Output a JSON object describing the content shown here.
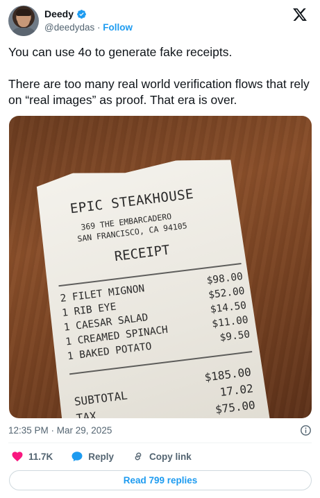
{
  "author": {
    "display_name": "Deedy",
    "handle": "@deedydas",
    "separator": "·",
    "follow_label": "Follow",
    "verified": true
  },
  "tweet": {
    "paragraphs": [
      "You can use 4o to generate fake receipts.",
      "There are too many real world verification flows that rely on “real images” as proof. That era is over."
    ],
    "timestamp": "12:35 PM · Mar 29, 2025"
  },
  "receipt": {
    "title": "EPIC STEAKHOUSE",
    "address": "369 THE EMBARCADERO",
    "city": "SAN FRANCISCO, CA 94105",
    "heading": "RECEIPT",
    "items": [
      {
        "name": "2 FILET MIGNON",
        "price": "$98.00"
      },
      {
        "name": "1 RIB EYE",
        "price": "$52.00"
      },
      {
        "name": "1 CAESAR SALAD",
        "price": "$14.50"
      },
      {
        "name": "1 CREAMED SPINACH",
        "price": "$11.00"
      },
      {
        "name": "1 BAKED POTATO",
        "price": "$9.50"
      }
    ],
    "subtotal_label": "SUBTOTAL",
    "subtotal_value": "$185.00",
    "tax_label": "TAX",
    "tax_value": "17.02",
    "total_value": "$75.00"
  },
  "actions": {
    "like_count": "11.7K",
    "reply_label": "Reply",
    "copy_link_label": "Copy link"
  },
  "read_replies_label": "Read 799 replies",
  "colors": {
    "accent": "#1d9bf0",
    "like": "#f91880",
    "text": "#0f1419",
    "muted": "#536471"
  },
  "icons": [
    "verified-badge-icon",
    "x-logo-icon",
    "info-icon",
    "heart-icon",
    "reply-bubble-icon",
    "link-icon"
  ]
}
